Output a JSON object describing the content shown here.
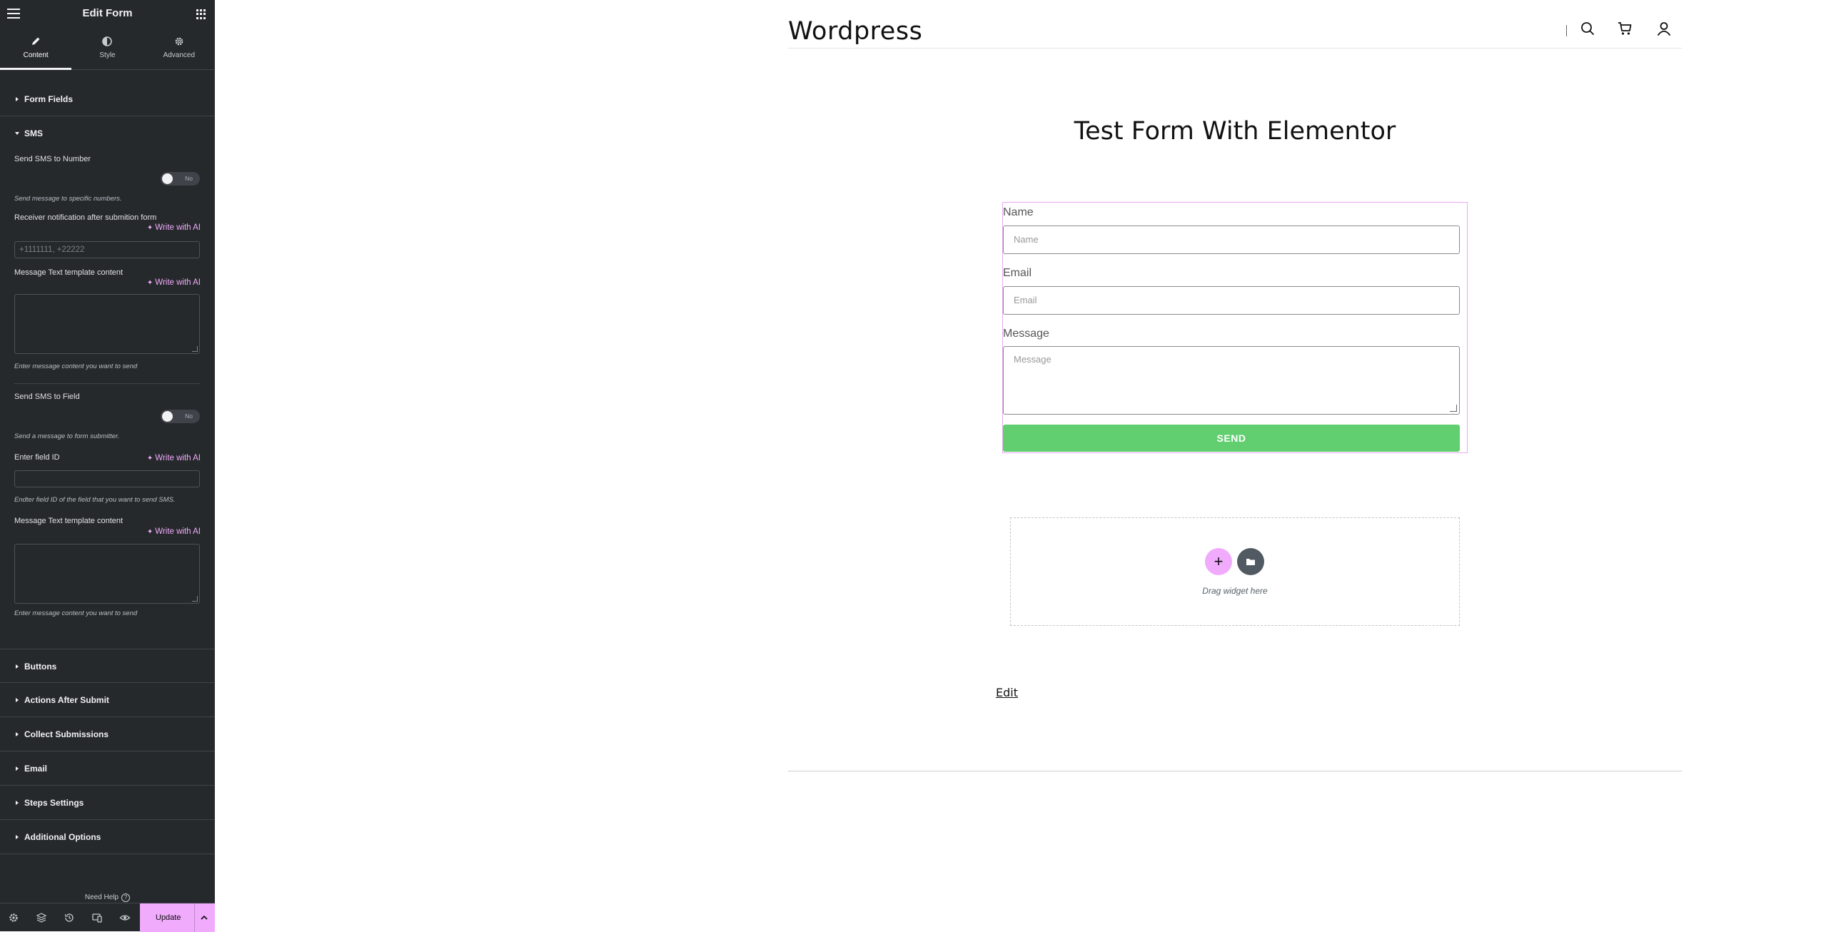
{
  "panel": {
    "title": "Edit Form",
    "tabs": [
      {
        "label": "Content",
        "icon": "pencil-icon",
        "active": true
      },
      {
        "label": "Style",
        "icon": "half-circle-icon",
        "active": false
      },
      {
        "label": "Advanced",
        "icon": "gear-icon",
        "active": false
      }
    ],
    "sections": {
      "form_fields": "Form Fields",
      "sms": "SMS",
      "buttons": "Buttons",
      "actions_after_submit": "Actions After Submit",
      "collect_submissions": "Collect Submissions",
      "email": "Email",
      "steps_settings": "Steps Settings",
      "additional_options": "Additional Options"
    },
    "sms": {
      "send_to_number_label": "Send SMS to Number",
      "send_to_number_toggle": "No",
      "send_to_number_desc": "Send message to specific numbers.",
      "receiver_label": "Receiver notification after submition form",
      "write_ai": "Write with AI",
      "receiver_placeholder": "+1111111, +22222",
      "msg_template_label": "Message Text template content",
      "msg_template_desc": "Enter message content you want to send",
      "send_to_field_label": "Send SMS to Field",
      "send_to_field_toggle": "No",
      "send_to_field_desc": "Send a message to form submitter.",
      "field_id_label": "Enter field ID",
      "field_id_desc": "Endter field ID of the field that you want to send SMS.",
      "msg_template2_label": "Message Text template content",
      "msg_template2_desc": "Enter message content you want to send"
    },
    "need_help": "Need Help",
    "update_label": "Update"
  },
  "site": {
    "title": "Wordpress",
    "page_heading": "Test Form With Elementor",
    "accent": "#f0abfc",
    "send_color": "#61ce70"
  },
  "form": {
    "fields": [
      {
        "label": "Name",
        "placeholder": "Name"
      },
      {
        "label": "Email",
        "placeholder": "Email"
      },
      {
        "label": "Message",
        "placeholder": "Message"
      }
    ],
    "submit": "SEND"
  },
  "drop_zone": {
    "text": "Drag widget here",
    "add": "+"
  },
  "edit_link": "Edit"
}
